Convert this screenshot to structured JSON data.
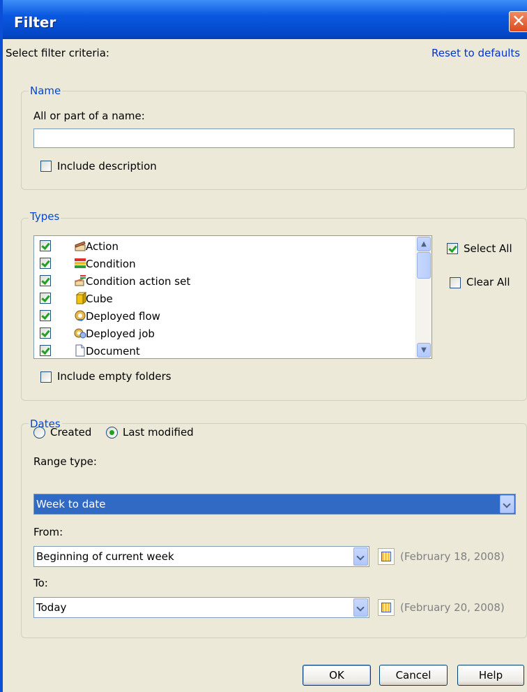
{
  "window": {
    "title": "Filter"
  },
  "header": {
    "instruction": "Select filter criteria:",
    "reset_link": "Reset to defaults"
  },
  "name_group": {
    "legend": "Name",
    "field_label": "All or part of a name:",
    "field_value": "",
    "include_description_label": "Include description",
    "include_description_checked": false
  },
  "types_group": {
    "legend": "Types",
    "items": [
      {
        "label": "Action",
        "checked": true,
        "icon": "action-icon"
      },
      {
        "label": "Condition",
        "checked": true,
        "icon": "condition-icon"
      },
      {
        "label": "Condition action set",
        "checked": true,
        "icon": "condition-action-set-icon"
      },
      {
        "label": "Cube",
        "checked": true,
        "icon": "cube-icon"
      },
      {
        "label": "Deployed flow",
        "checked": true,
        "icon": "deployed-flow-icon"
      },
      {
        "label": "Deployed job",
        "checked": true,
        "icon": "deployed-job-icon"
      },
      {
        "label": "Document",
        "checked": true,
        "icon": "document-icon"
      }
    ],
    "select_all_label": "Select All",
    "select_all_checked": true,
    "clear_all_label": "Clear All",
    "clear_all_checked": false,
    "include_empty_folders_label": "Include empty folders",
    "include_empty_folders_checked": false
  },
  "dates_group": {
    "legend": "Dates",
    "radio_created": "Created",
    "radio_last_modified": "Last modified",
    "selected_radio": "Last modified",
    "range_type_label": "Range type:",
    "range_type_value": "Week to date",
    "from_label": "From:",
    "from_value": "Beginning of current week",
    "from_date_hint": "(February 18, 2008)",
    "to_label": "To:",
    "to_value": "Today",
    "to_date_hint": "(February 20, 2008)"
  },
  "buttons": {
    "ok": "OK",
    "cancel": "Cancel",
    "help": "Help"
  },
  "colors": {
    "title_bar": "#0a58e0",
    "selection": "#316ac5",
    "link": "#0033cc",
    "group_legend": "#0046d5"
  }
}
